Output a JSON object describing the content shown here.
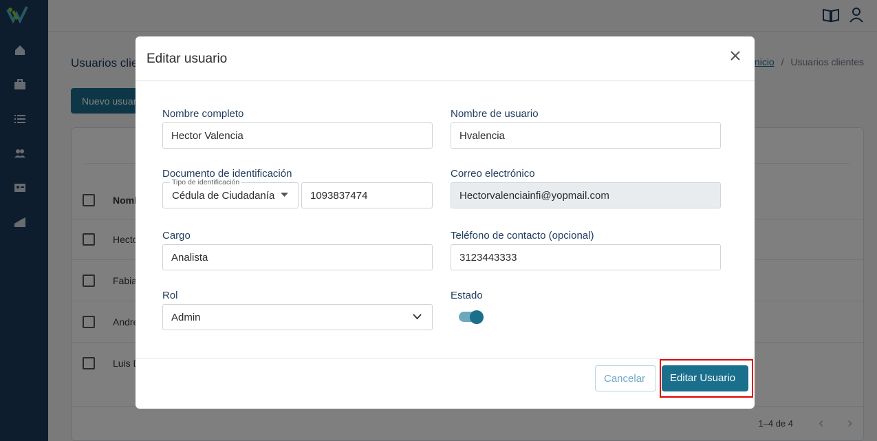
{
  "page": {
    "title": "Usuarios clie",
    "breadcrumb": {
      "home": "Inicio",
      "sep": "/",
      "current": "Usuarios clientes"
    },
    "new_button": "Nuevo usuar"
  },
  "table": {
    "header_name": "Nomb",
    "rows": [
      "Hecto",
      "Fabia",
      "Andre",
      "Luis D"
    ],
    "pagination": "1–4 de 4"
  },
  "sidebar": {
    "icons": [
      "home-icon",
      "briefcase-icon",
      "list-icon",
      "users-icon",
      "id-card-icon",
      "chart-icon"
    ]
  },
  "topbar": {
    "icons": [
      "book-icon",
      "user-icon"
    ]
  },
  "modal": {
    "title": "Editar usuario",
    "fields": {
      "full_name": {
        "label": "Nombre completo",
        "value": "Hector Valencia"
      },
      "username": {
        "label": "Nombre de usuario",
        "value": "Hvalencia"
      },
      "document": {
        "label": "Documento de identificación",
        "type_label": "Tipo de identificación",
        "type_value": "Cédula de Ciudadanía",
        "number": "1093837474"
      },
      "email": {
        "label": "Correo electrónico",
        "value": "Hectorvalenciainfi@yopmail.com"
      },
      "position": {
        "label": "Cargo",
        "value": "Analista"
      },
      "phone": {
        "label": "Teléfono de contacto (opcional)",
        "value": "3123443333"
      },
      "role": {
        "label": "Rol",
        "value": "Admin"
      },
      "status": {
        "label": "Estado",
        "on": true
      }
    },
    "cancel": "Cancelar",
    "submit": "Editar Usuario"
  },
  "colors": {
    "primary": "#1a6f8c",
    "sidebar": "#1a3a5c",
    "highlight": "#e00000"
  }
}
